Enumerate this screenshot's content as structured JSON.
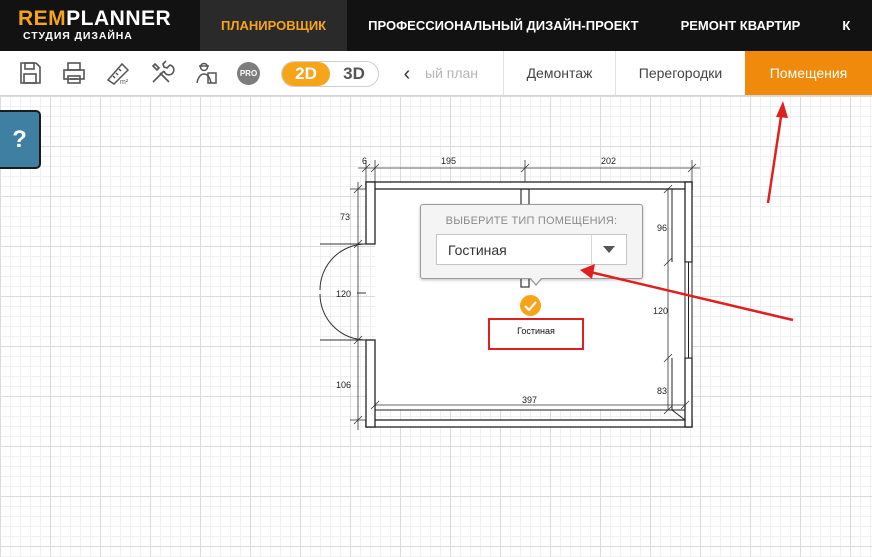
{
  "logo": {
    "part1": "REM",
    "part2": "PLANNER",
    "subtitle": "СТУДИЯ ДИЗАЙНА"
  },
  "nav": [
    {
      "label": "ПЛАНИРОВЩИК",
      "active": true
    },
    {
      "label": "ПРОФЕССИОНАЛЬНЫЙ ДИЗАЙН-ПРОЕКТ",
      "active": false
    },
    {
      "label": "РЕМОНТ КВАРТИР",
      "active": false
    },
    {
      "label": "К",
      "active": false
    }
  ],
  "toolbar": {
    "icons": [
      "save-icon",
      "print-icon",
      "area-ruler-icon",
      "tools-icon",
      "worker-icon"
    ],
    "pro_label": "PRO",
    "mode_2d": "2D",
    "mode_3d": "3D",
    "back_arrow": "‹",
    "tabs": [
      {
        "label": "ый план",
        "active": false,
        "faded": true
      },
      {
        "label": "Демонтаж",
        "active": false
      },
      {
        "label": "Перегородки",
        "active": false
      },
      {
        "label": "Помещения",
        "active": true
      }
    ]
  },
  "help": {
    "label": "?"
  },
  "plan": {
    "dimensions": {
      "top_left": "6",
      "top_mid": "195",
      "top_right": "202",
      "left_top": "73",
      "left_mid": "120",
      "left_bottom": "106",
      "right_top": "96",
      "right_mid": "120",
      "right_bottom": "83",
      "bottom": "397"
    }
  },
  "popup": {
    "title": "ВЫБЕРИТЕ ТИП ПОМЕЩЕНИЯ:",
    "selected": "Гостиная"
  },
  "room": {
    "label": "Гостиная"
  },
  "colors": {
    "accent": "#f7a41a",
    "active_tab": "#f08a0c",
    "annotation": "#e0201f",
    "help": "#3f7fa1"
  }
}
